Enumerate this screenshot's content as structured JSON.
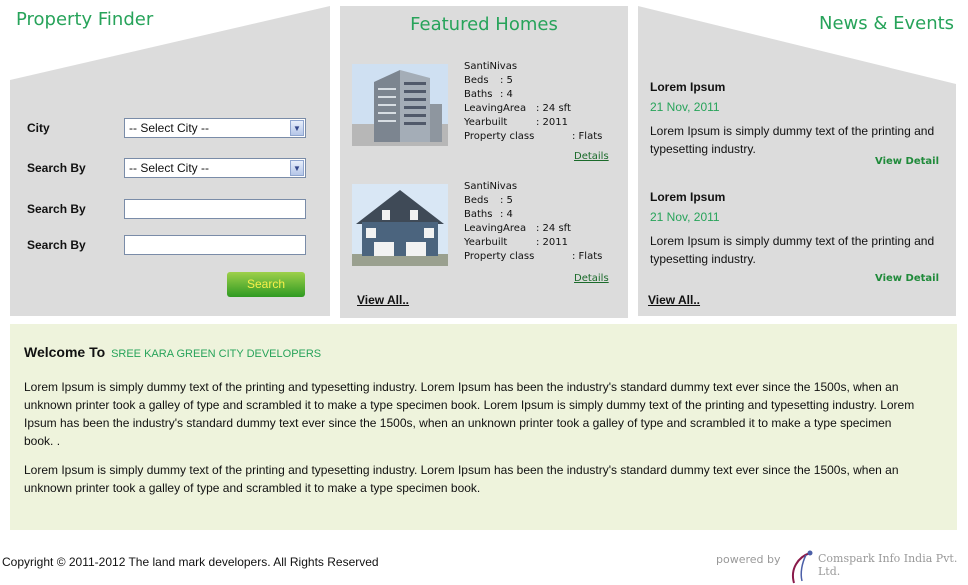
{
  "property_finder": {
    "title": "Property Finder",
    "city_label": "City",
    "city_select": "-- Select City --",
    "search_by_1_label": "Search By",
    "search_by_1_select": "-- Select City --",
    "search_by_2_label": "Search By",
    "search_by_3_label": "Search By",
    "search_button": "Search"
  },
  "featured": {
    "title": "Featured Homes",
    "properties": [
      {
        "name": "SantiNivas",
        "beds_label": "Beds",
        "beds": ": 5",
        "baths_label": "Baths",
        "baths": ": 4",
        "area_label": "LeavingArea",
        "area": ": 24 sft",
        "year_label": "Yearbuilt",
        "year": ": 2011",
        "class_label": "Property class",
        "class": ": Flats",
        "details": "Details"
      },
      {
        "name": "SantiNivas",
        "beds_label": "Beds",
        "beds": ": 5",
        "baths_label": "Baths",
        "baths": ": 4",
        "area_label": "LeavingArea",
        "area": ": 24 sft",
        "year_label": "Yearbuilt",
        "year": ": 2011",
        "class_label": "Property class",
        "class": ": Flats",
        "details": "Details"
      }
    ],
    "view_all": "View All.."
  },
  "news": {
    "title": "News & Events",
    "items": [
      {
        "title": "Lorem Ipsum",
        "date": "21 Nov, 2011",
        "text": "Lorem Ipsum is simply dummy text of the printing and typesetting industry.",
        "link": "View Detail"
      },
      {
        "title": "Lorem Ipsum",
        "date": "21 Nov, 2011",
        "text": "Lorem Ipsum is simply dummy text of the printing and typesetting industry.",
        "link": "View Detail"
      }
    ],
    "view_all": "View All.."
  },
  "welcome": {
    "prefix": "Welcome To",
    "company": "SREE KARA GREEN CITY DEVELOPERS",
    "para1": "Lorem Ipsum is simply dummy text of the printing and typesetting industry. Lorem Ipsum has been the industry's standard dummy text ever since the 1500s, when an unknown printer took a galley of type and scrambled it to make a type specimen book. Lorem Ipsum is simply dummy text of the printing and typesetting industry. Lorem Ipsum has been the industry's standard dummy text ever since the 1500s, when an unknown printer took a galley of type and scrambled it to make a type specimen book. .",
    "para2": "Lorem Ipsum is simply dummy text of the printing and typesetting industry. Lorem Ipsum has been the industry's standard dummy text ever since the 1500s, when an unknown printer took a galley of type and scrambled it to make a type specimen book."
  },
  "footer": {
    "copyright": "Copyright © 2011-2012 The land mark developers. All Rights Reserved",
    "powered_by": "powered by",
    "company_logo_text": "Comspark Info India Pvt. Ltd."
  },
  "colors": {
    "accent_green": "#27a35a",
    "panel_gray": "#dcdcdc",
    "welcome_bg": "#eef3dc"
  }
}
